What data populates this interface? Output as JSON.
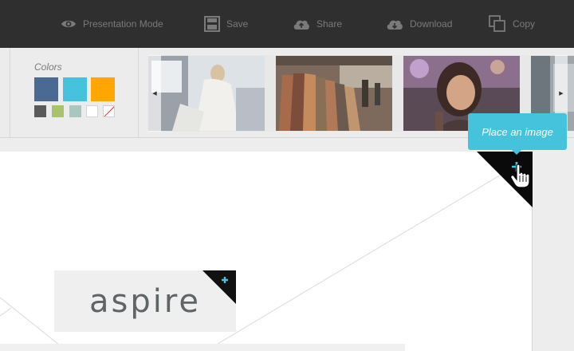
{
  "toolbar": {
    "presentation_label": "Presentation Mode",
    "save_label": "Save",
    "share_label": "Share",
    "download_label": "Download",
    "copy_label": "Copy",
    "icons": [
      "eye-icon",
      "save-icon",
      "cloud-upload-icon",
      "cloud-download-icon",
      "copy-icon"
    ]
  },
  "colors_panel": {
    "title": "Colors",
    "primary_swatches": [
      "#4a6a94",
      "#45c3dc",
      "#ffa600"
    ],
    "secondary_swatches": [
      "#5a5a5a",
      "#a9c26c",
      "#a9c6c1",
      "#ffffff",
      "none"
    ]
  },
  "gallery": {
    "images": [
      "woman-in-car-photo",
      "clothing-rack-photo",
      "woman-smiling-photo",
      "partial-photo"
    ],
    "left_arrow_icon": "chevron-left-icon",
    "right_arrow_icon": "chevron-right-icon"
  },
  "tooltip": {
    "text": "Place an image"
  },
  "canvas": {
    "logo_text": "aspire"
  },
  "colors": {
    "toolbar_bg": "#2f2f2f",
    "accent": "#45c3dc",
    "corner_black": "#000000"
  }
}
